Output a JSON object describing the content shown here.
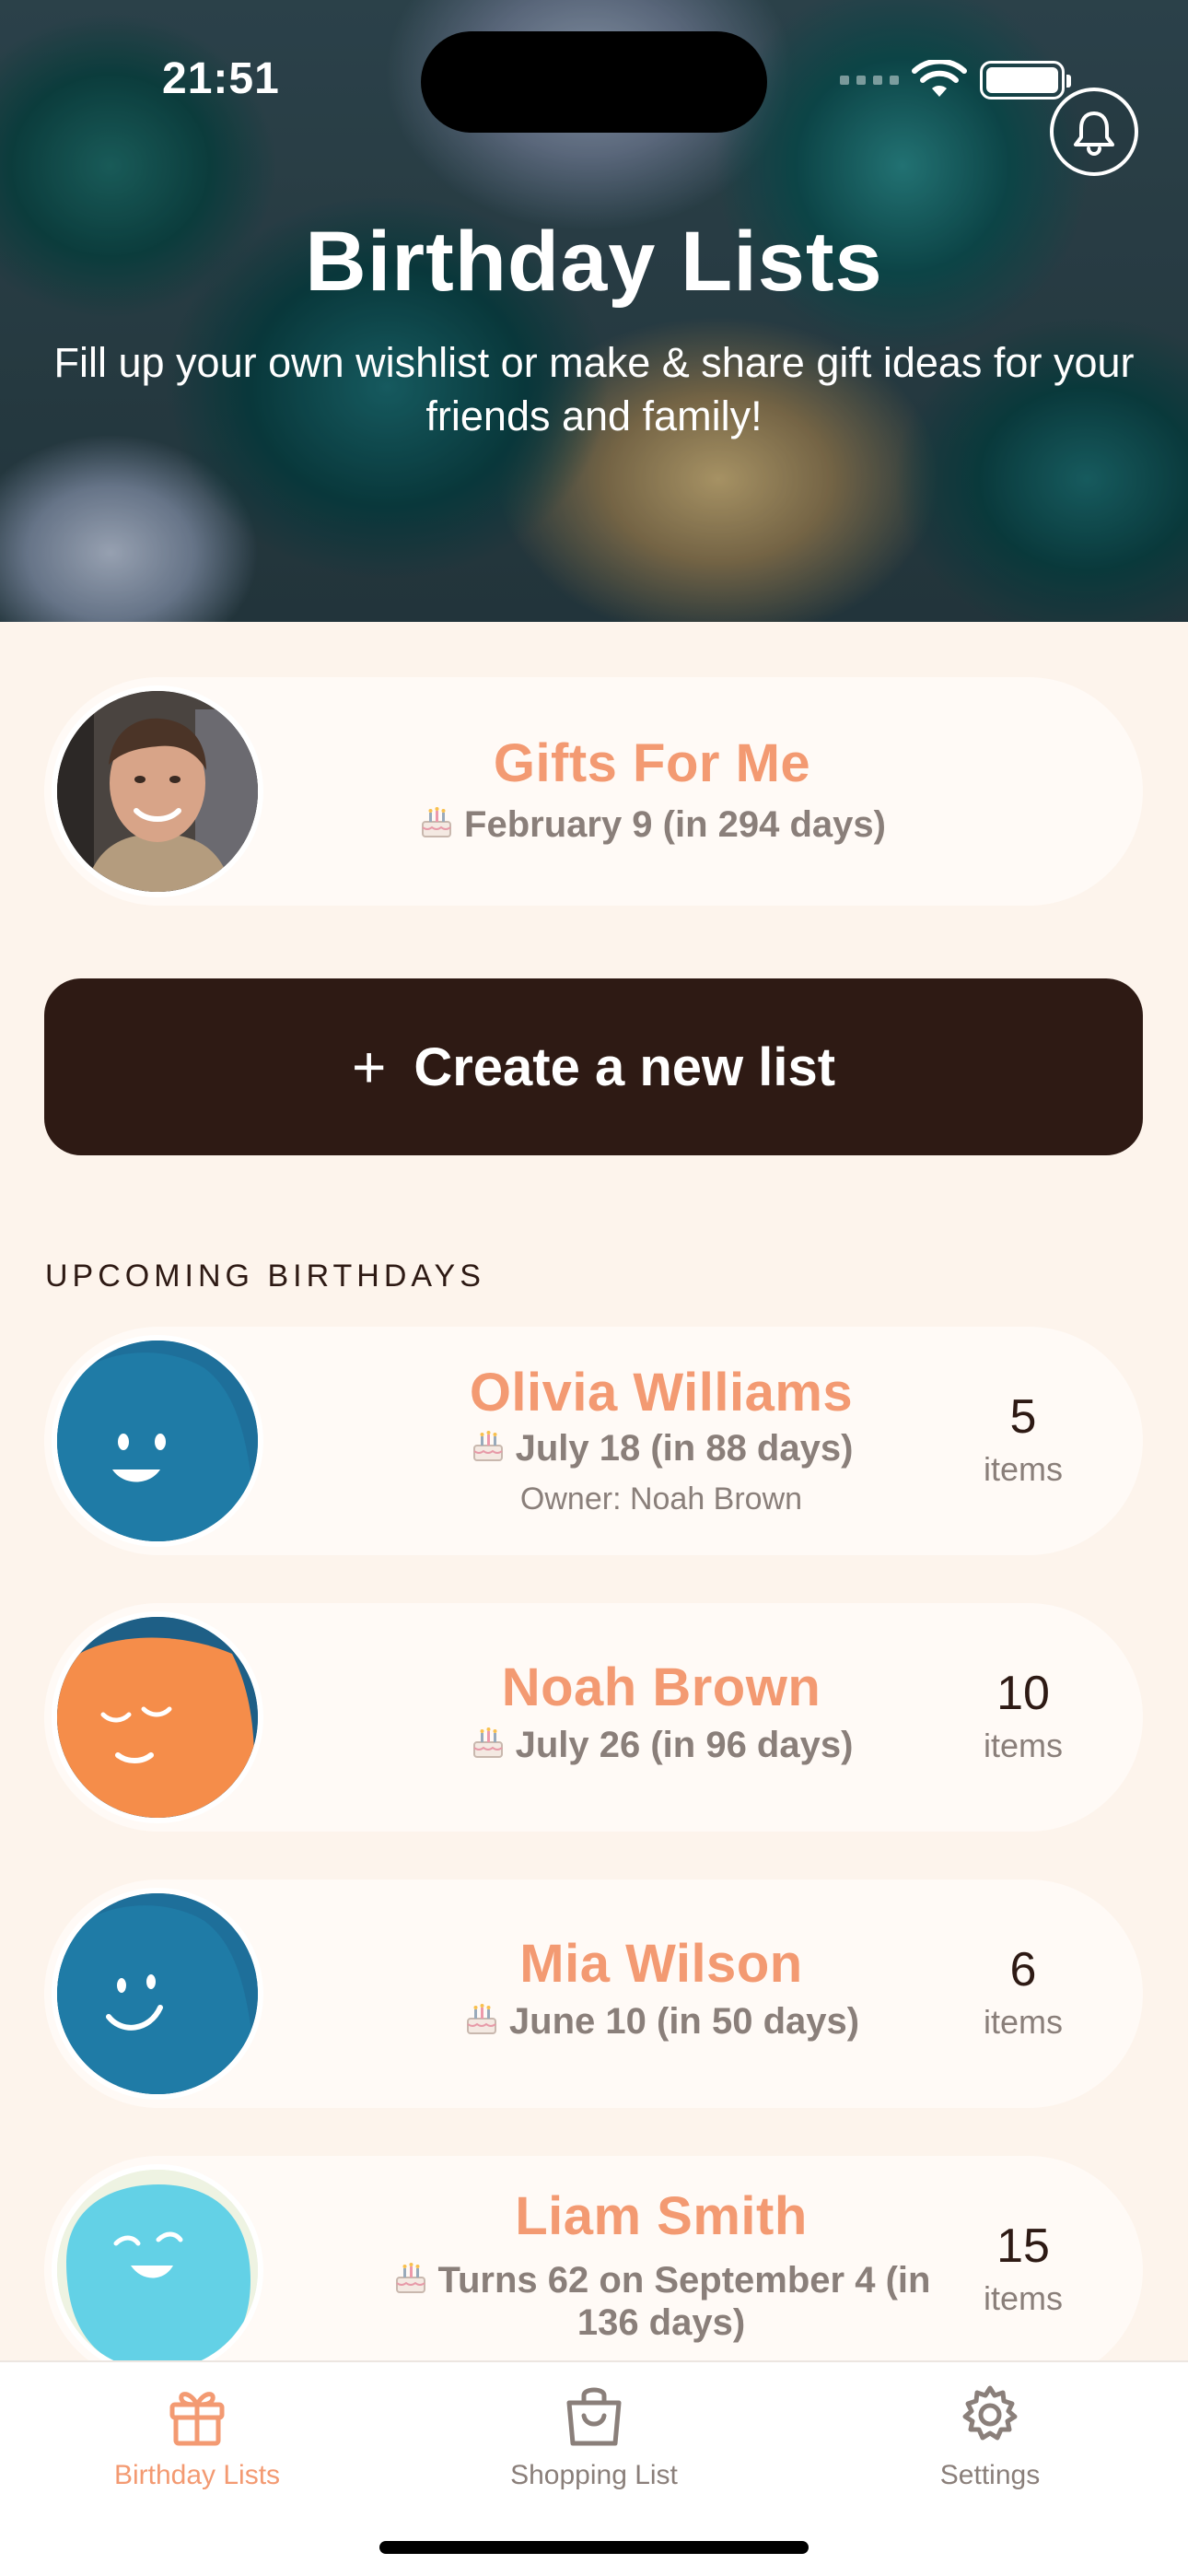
{
  "status_bar": {
    "time": "21:51"
  },
  "header": {
    "title": "Birthday Lists",
    "subtitle": "Fill up your own wishlist or make & share gift ideas for your friends and family!",
    "notification_icon": "bell-icon"
  },
  "my_list": {
    "title": "Gifts For Me",
    "date": "February 9 (in 294 days)",
    "date_icon": "cake-icon"
  },
  "create_button": {
    "icon": "plus-icon",
    "label": "Create a new list"
  },
  "upcoming": {
    "section_title": "UPCOMING BIRTHDAYS",
    "items": [
      {
        "name": "Olivia Williams",
        "date": "July 18 (in 88 days)",
        "owner": "Owner: Noah Brown",
        "count": "5",
        "count_label": "items"
      },
      {
        "name": "Noah Brown",
        "date": "July 26 (in 96 days)",
        "count": "10",
        "count_label": "items"
      },
      {
        "name": "Mia Wilson",
        "date": "June 10 (in 50 days)",
        "count": "6",
        "count_label": "items"
      },
      {
        "name": "Liam Smith",
        "date_line1": "Turns 62 on September 4 (in",
        "date_line2": "136 days)",
        "count": "15",
        "count_label": "items"
      }
    ]
  },
  "tab_bar": {
    "tabs": [
      {
        "label": "Birthday Lists",
        "icon": "gift-icon",
        "active": true
      },
      {
        "label": "Shopping List",
        "icon": "shopping-bag-icon",
        "active": false
      },
      {
        "label": "Settings",
        "icon": "gear-icon",
        "active": false
      }
    ]
  },
  "colors": {
    "accent": "#f39a72",
    "dark": "#2e1a14",
    "background": "#fdf4ec",
    "card": "#fffaf6",
    "muted": "#8a7f7a"
  }
}
